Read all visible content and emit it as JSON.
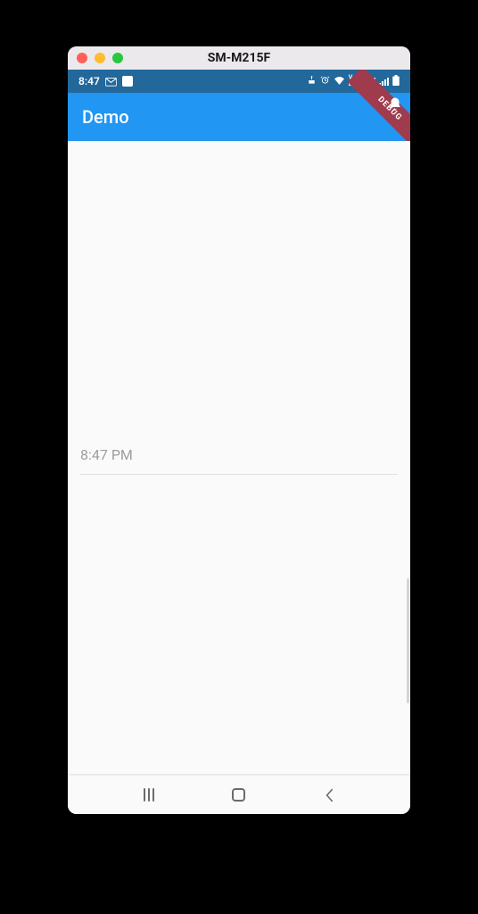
{
  "window": {
    "title": "SM-M215F"
  },
  "statusBar": {
    "time": "8:47",
    "lte": "VoLTE1"
  },
  "appBar": {
    "title": "Demo"
  },
  "debugBanner": "DEBUG",
  "content": {
    "timeDisplay": "8:47 PM"
  }
}
